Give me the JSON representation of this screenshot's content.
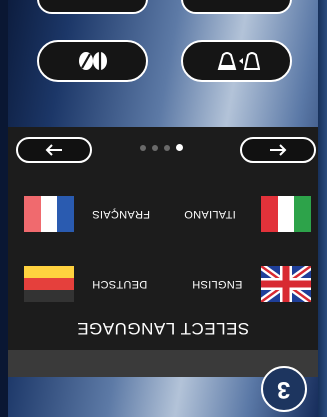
{
  "nav": {
    "back_icon": "arrow-left-icon",
    "forward_icon": "arrow-right-icon",
    "dots": [
      false,
      false,
      false,
      true
    ]
  },
  "top_buttons": {
    "beans_icon": "coffee-beans-icon",
    "pitcher_icon": "milk-pitcher-icon"
  },
  "languages": [
    {
      "id": "francais",
      "label": "FRANÇAIS",
      "flag": "france"
    },
    {
      "id": "italiano",
      "label": "ITALIANO",
      "flag": "italy"
    },
    {
      "id": "deutsch",
      "label": "DEUTSCH",
      "flag": "germany"
    },
    {
      "id": "english",
      "label": "ENGLISH",
      "flag": "uk"
    }
  ],
  "title": "SELECT LANGUAGE",
  "step_badge": "3",
  "colors": {
    "panel": "#1c1c1c",
    "bottom_bar": "#3a3a3a",
    "badge": "#1d355f"
  }
}
